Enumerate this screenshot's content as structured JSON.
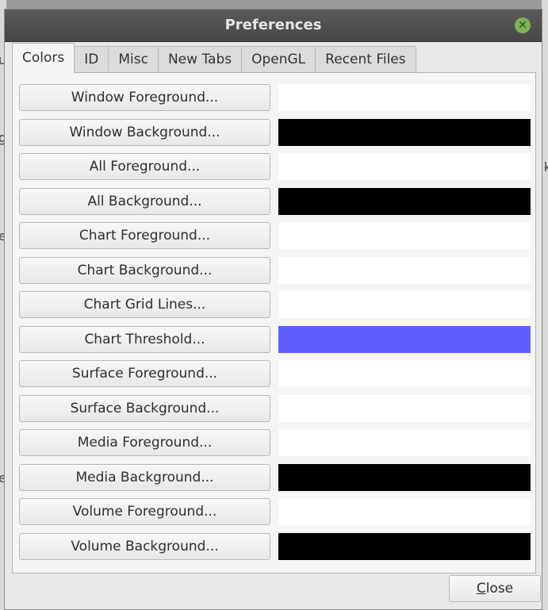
{
  "window": {
    "title": "Preferences"
  },
  "background_fragments": {
    "left": [
      "u",
      "g",
      "e",
      "e"
    ],
    "right": [
      "k"
    ]
  },
  "tabs": [
    {
      "label": "Colors",
      "active": true
    },
    {
      "label": "ID",
      "active": false
    },
    {
      "label": "Misc",
      "active": false
    },
    {
      "label": "New Tabs",
      "active": false
    },
    {
      "label": "OpenGL",
      "active": false
    },
    {
      "label": "Recent Files",
      "active": false
    }
  ],
  "color_rows": [
    {
      "label": "Window Foreground...",
      "color": "#ffffff"
    },
    {
      "label": "Window Background...",
      "color": "#000000"
    },
    {
      "label": "All Foreground...",
      "color": "#ffffff"
    },
    {
      "label": "All Background...",
      "color": "#000000"
    },
    {
      "label": "Chart Foreground...",
      "color": "#ffffff"
    },
    {
      "label": "Chart Background...",
      "color": "#ffffff"
    },
    {
      "label": "Chart Grid Lines...",
      "color": "#ffffff"
    },
    {
      "label": "Chart Threshold...",
      "color": "#5f5fff"
    },
    {
      "label": "Surface Foreground...",
      "color": "#ffffff"
    },
    {
      "label": "Surface Background...",
      "color": "#ffffff"
    },
    {
      "label": "Media Foreground...",
      "color": "#ffffff"
    },
    {
      "label": "Media Background...",
      "color": "#000000"
    },
    {
      "label": "Volume Foreground...",
      "color": "#ffffff"
    },
    {
      "label": "Volume Background...",
      "color": "#000000"
    }
  ],
  "footer": {
    "close_mnemonic": "C",
    "close_rest": "lose"
  },
  "icons": {
    "close": "close-icon"
  },
  "colors": {
    "titlebar": "#4e4e4c",
    "close_icon": "#7fb257"
  }
}
